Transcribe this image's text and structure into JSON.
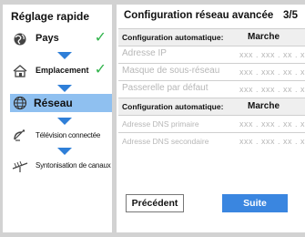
{
  "sidebar": {
    "title": "Réglage rapide",
    "steps": [
      {
        "label": "Pays",
        "icon": "globe-icon",
        "done": true
      },
      {
        "label": "Emplacement",
        "icon": "house-icon",
        "done": true
      },
      {
        "label": "Réseau",
        "icon": "network-globe-icon",
        "done": false,
        "active": true
      },
      {
        "label": "Télévision connectée",
        "icon": "satellite-icon",
        "done": false
      },
      {
        "label": "Syntonisation de canaux",
        "icon": "antenna-icon",
        "done": false
      }
    ],
    "check_symbol": "✓"
  },
  "main": {
    "title": "Configuration réseau avancée",
    "step": "3/5",
    "rows": [
      {
        "label": "Configuration automatique:",
        "value": "Marche"
      },
      {
        "label": "Adresse IP",
        "value": "xxx . xxx .  xx . x"
      },
      {
        "label": "Masque de sous-réseau",
        "value": "xxx . xxx .  xx . x"
      },
      {
        "label": "Passerelle par défaut",
        "value": "xxx . xxx .  xx . x"
      },
      {
        "label": "Configuration automatique:",
        "value": "Marche"
      },
      {
        "label": "Adresse DNS primaire",
        "value": "xxx . xxx .  xx . x"
      },
      {
        "label": "Adresse DNS secondaire",
        "value": "xxx . xxx .  xx . x"
      }
    ]
  },
  "buttons": {
    "prev": "Précédent",
    "next": "Suite"
  },
  "colors": {
    "accent": "#3a86e0",
    "active_row": "#8fc0f0",
    "check": "#2fb34a",
    "arrow": "#2f7fd8"
  }
}
